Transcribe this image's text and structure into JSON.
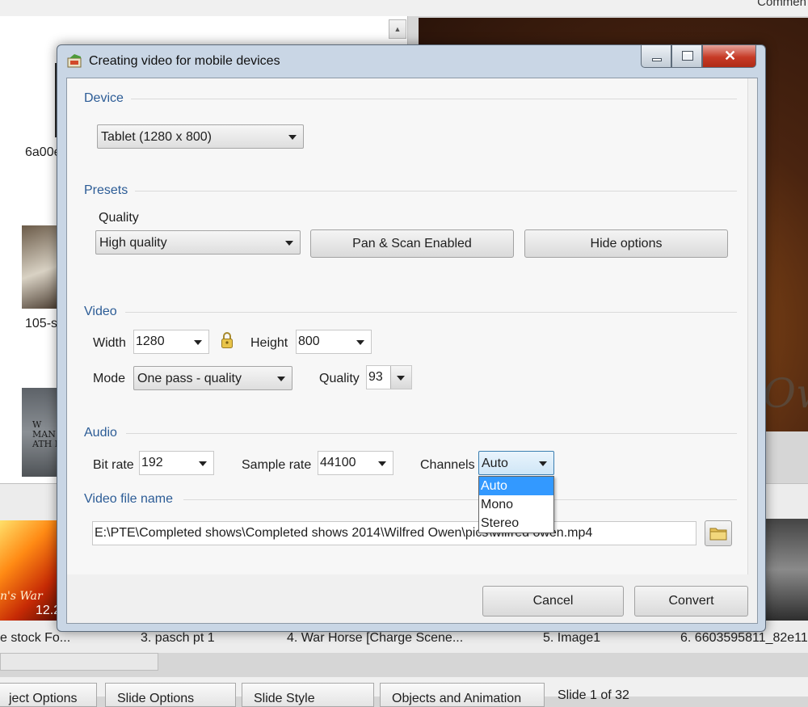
{
  "background": {
    "top_right_text": "Commen",
    "left_labels": [
      "6a00e",
      "105-s"
    ],
    "thumb_text": "W\nMAN\nATH N",
    "fire_caption": "n's War",
    "fire_number": "12.2",
    "slide_captions": [
      "e stock Fo...",
      "3. pasch pt 1",
      "4. War Horse [Charge Scene...",
      "5. Image1",
      "6. 6603595811_82e11"
    ],
    "preview_text": "Ow",
    "bottom_tabs": [
      "ject Options",
      "Slide Options",
      "Slide Style",
      "Objects and Animation"
    ],
    "slide_counter": "Slide 1 of 32"
  },
  "dialog": {
    "title": "Creating video for mobile devices",
    "close_glyph": "✕",
    "device": {
      "section": "Device",
      "selected": "Tablet (1280 x 800)"
    },
    "presets": {
      "section": "Presets",
      "quality_label": "Quality",
      "quality_selected": "High quality",
      "pan_scan_button": "Pan & Scan Enabled",
      "hide_options_button": "Hide options"
    },
    "video": {
      "section": "Video",
      "width_label": "Width",
      "width_value": "1280",
      "height_label": "Height",
      "height_value": "800",
      "mode_label": "Mode",
      "mode_value": "One pass - quality",
      "quality_label": "Quality",
      "quality_value": "93"
    },
    "audio": {
      "section": "Audio",
      "bitrate_label": "Bit rate",
      "bitrate_value": "192",
      "samplerate_label": "Sample rate",
      "samplerate_value": "44100",
      "channels_label": "Channels",
      "channels_value": "Auto",
      "channels_options": [
        "Auto",
        "Mono",
        "Stereo"
      ]
    },
    "file": {
      "section": "Video file name",
      "path": "E:\\PTE\\Completed shows\\Completed shows 2014\\Wilfred Owen\\pics\\wilfred owen.mp4"
    },
    "cancel_button": "Cancel",
    "convert_button": "Convert"
  },
  "colors": {
    "section_title": "#2c5c96",
    "selection": "#3399ff",
    "close_button": "#c63a26"
  }
}
